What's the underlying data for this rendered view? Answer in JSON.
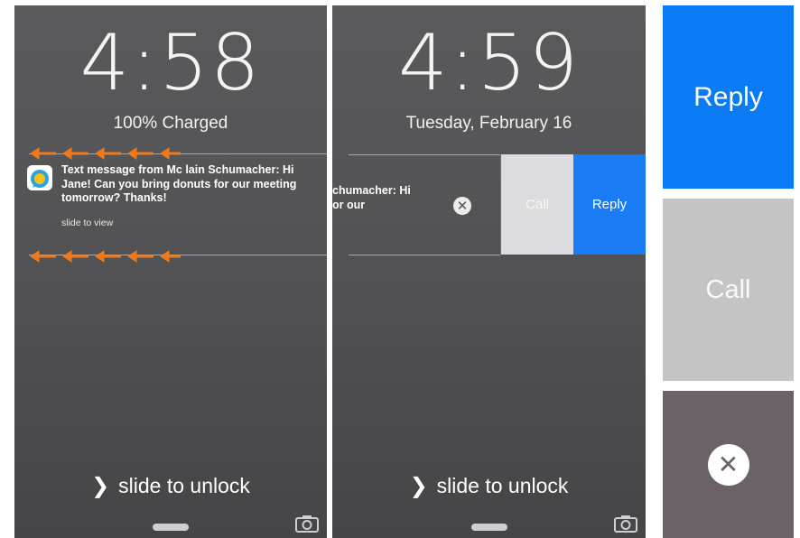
{
  "screen1": {
    "time": "4:58",
    "status": "100% Charged",
    "notification": {
      "text": "Text message from Mc lain Schumacher: Hi Jane! Can you bring donuts for our meeting tomorrow? Thanks!",
      "hint": "slide to view",
      "icon": "chat-app-icon"
    },
    "slide_to_unlock": "slide to unlock",
    "gesture_arrow_color": "#f07a1a"
  },
  "screen2": {
    "time": "4:59",
    "date": "Tuesday, February 16",
    "notification_partial": [
      "chumacher: Hi",
      "or our"
    ],
    "actions": {
      "dismiss_icon": "close-icon",
      "call_label": "Call",
      "reply_label": "Reply"
    },
    "slide_to_unlock": "slide to unlock"
  },
  "detail": {
    "reply_label": "Reply",
    "call_label": "Call",
    "dismiss_icon": "close-icon",
    "reply_color": "#0a7bf4",
    "call_color": "#c4c4c4",
    "dismiss_color": "#6b6168"
  }
}
